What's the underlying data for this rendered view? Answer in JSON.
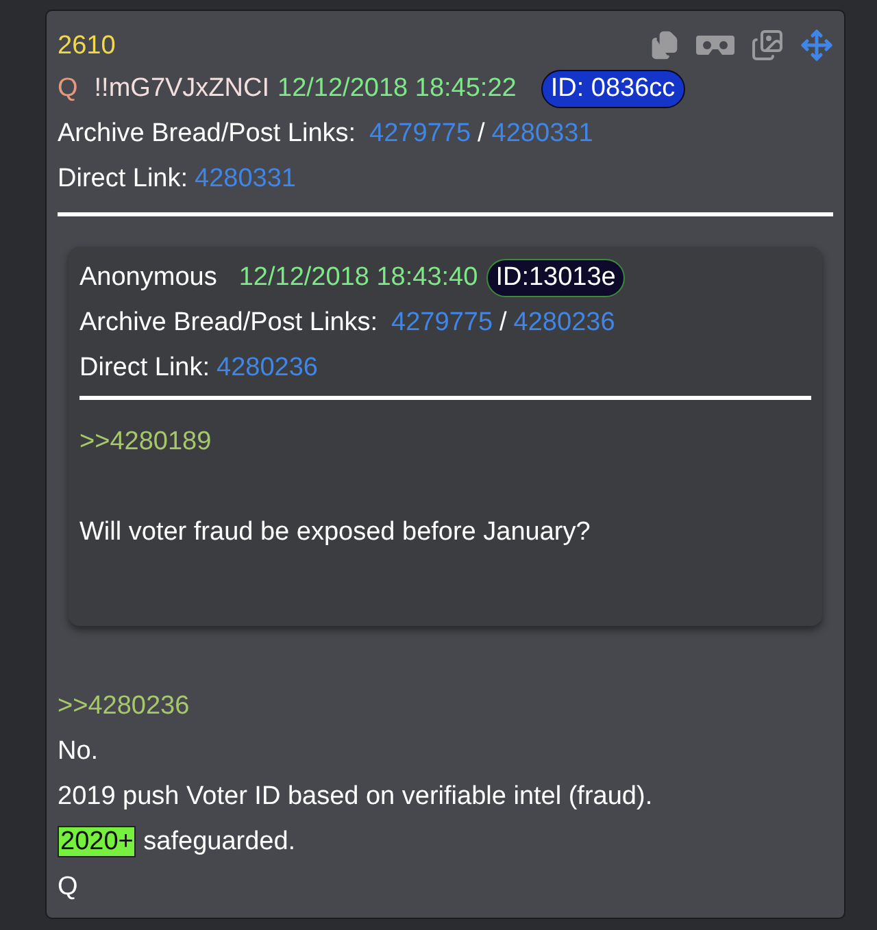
{
  "post": {
    "number": "2610",
    "author": "Q",
    "tripcode": "!!mG7VJxZNCI",
    "timestamp": "12/12/2018 18:45:22",
    "id_badge": "ID: 0836cc",
    "archive": {
      "label": "Archive Bread/Post Links:",
      "bread": "4279775",
      "separator": "/",
      "post": "4280331"
    },
    "direct": {
      "label": "Direct Link:",
      "link": "4280331"
    },
    "quoted": {
      "author": "Anonymous",
      "timestamp": "12/12/2018 18:43:40",
      "id_badge": "ID:13013e",
      "archive": {
        "label": "Archive Bread/Post Links:",
        "bread": "4279775",
        "separator": "/",
        "post": "4280236"
      },
      "direct": {
        "label": "Direct Link:",
        "link": "4280236"
      },
      "lines": [
        {
          "kind": "quote",
          "text": ">>4280189"
        },
        {
          "kind": "gap"
        },
        {
          "kind": "text",
          "text": "Will voter fraud be exposed before January?"
        }
      ]
    },
    "lines": [
      {
        "kind": "quote",
        "text": ">>4280236"
      },
      {
        "kind": "text",
        "text": "No."
      },
      {
        "kind": "text",
        "text": "2019 push Voter ID based on verifiable intel (fraud)."
      },
      {
        "kind": "highlighted",
        "highlight": "2020+",
        "text": "safeguarded."
      },
      {
        "kind": "text",
        "text": "Q"
      }
    ]
  }
}
